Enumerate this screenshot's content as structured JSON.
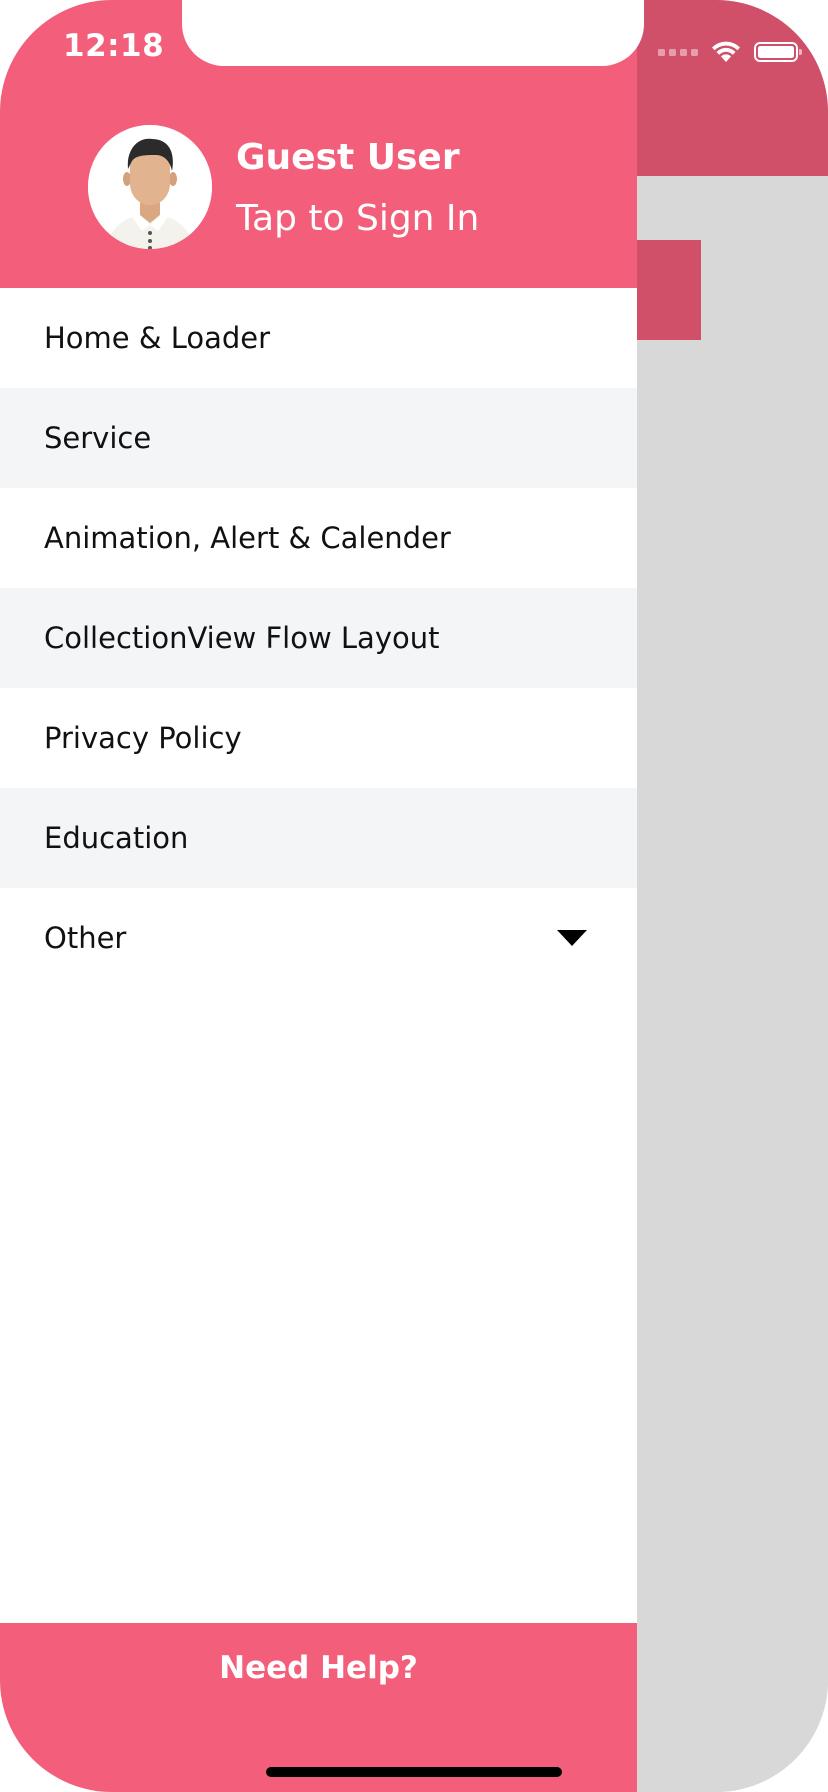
{
  "status_bar": {
    "time": "12:18"
  },
  "profile": {
    "name": "Guest User",
    "action": "Tap to Sign In",
    "avatar_icon": "person-avatar-icon"
  },
  "menu": {
    "items": [
      {
        "label": "Home & Loader"
      },
      {
        "label": "Service"
      },
      {
        "label": "Animation, Alert & Calender"
      },
      {
        "label": "CollectionView Flow Layout"
      },
      {
        "label": "Privacy Policy"
      },
      {
        "label": "Education"
      },
      {
        "label": "Other",
        "expandable": true,
        "icon": "caret-down-icon"
      }
    ]
  },
  "footer": {
    "help_label": "Need Help?"
  },
  "colors": {
    "accent": "#f35e7b",
    "accent_dim": "#cf5068",
    "row_alt": "#f4f5f7",
    "dim_background": "#d8d8d8"
  }
}
